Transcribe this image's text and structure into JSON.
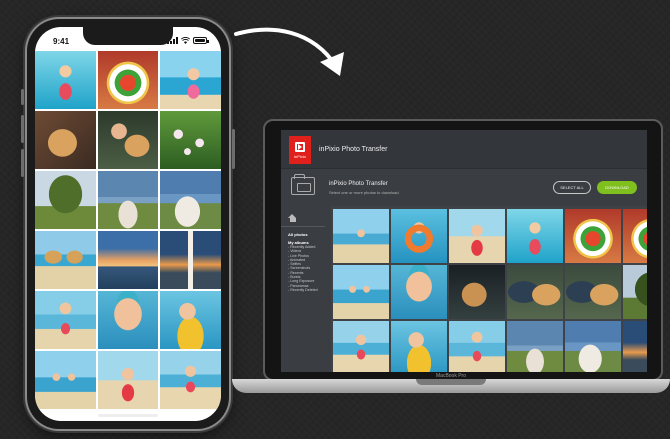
{
  "phone": {
    "time": "9:41",
    "status_icons": [
      "signal-icon",
      "wifi-icon",
      "battery-icon"
    ],
    "photos": [
      "ph-pool",
      "ph-food",
      "ph-beachgirl",
      "ph-dog",
      "ph-woman-dog",
      "ph-flowers",
      "ph-tree",
      "ph-church",
      "ph-house",
      "ph-umbrellas",
      "ph-sunset",
      "ph-lighthouse",
      "ph-girl-beach2",
      "ph-goggles",
      "ph-girl-float",
      "ph-kids-sea",
      "ph-girl-red",
      "ph-girl-run"
    ]
  },
  "arrow": {
    "icon": "curved-arrow-icon",
    "color": "#ffffff"
  },
  "laptop": {
    "model_label": "MacBook Pro",
    "app": {
      "logo_text": "inPixio",
      "title": "inPixio Photo Transfer",
      "accent_color": "#e0201b",
      "toolbar": {
        "title": "inPixio Photo Transfer",
        "subtitle": "Select one or more photos to download",
        "select_all_label": "SELECT ALL",
        "download_label": "DOWNLOAD",
        "download_color": "#7fbf1e"
      },
      "sidebar": {
        "all_photos_label": "All photos",
        "albums_heading": "My albums",
        "albums": [
          "- Recently Added",
          "- Videos",
          "- Live Photos",
          "- Animated",
          "- Selfies",
          "- Screenshots",
          "- Recents",
          "- Bursts",
          "- Long Exposure",
          "- Panoramas",
          "- Recently Deleted"
        ]
      },
      "photos": [
        "ph-girl-small",
        "ph-ring",
        "ph-girl-red",
        "ph-pool",
        "ph-food",
        "ph-food",
        "ph-kids-sea",
        "ph-goggles",
        "ph-dark",
        "ph-dog-coat",
        "ph-dog-coat",
        "ph-tree2",
        "ph-girl-run",
        "ph-girl-float",
        "ph-girl-beach2",
        "ph-church",
        "ph-house",
        "ph-lighthouse"
      ]
    }
  }
}
